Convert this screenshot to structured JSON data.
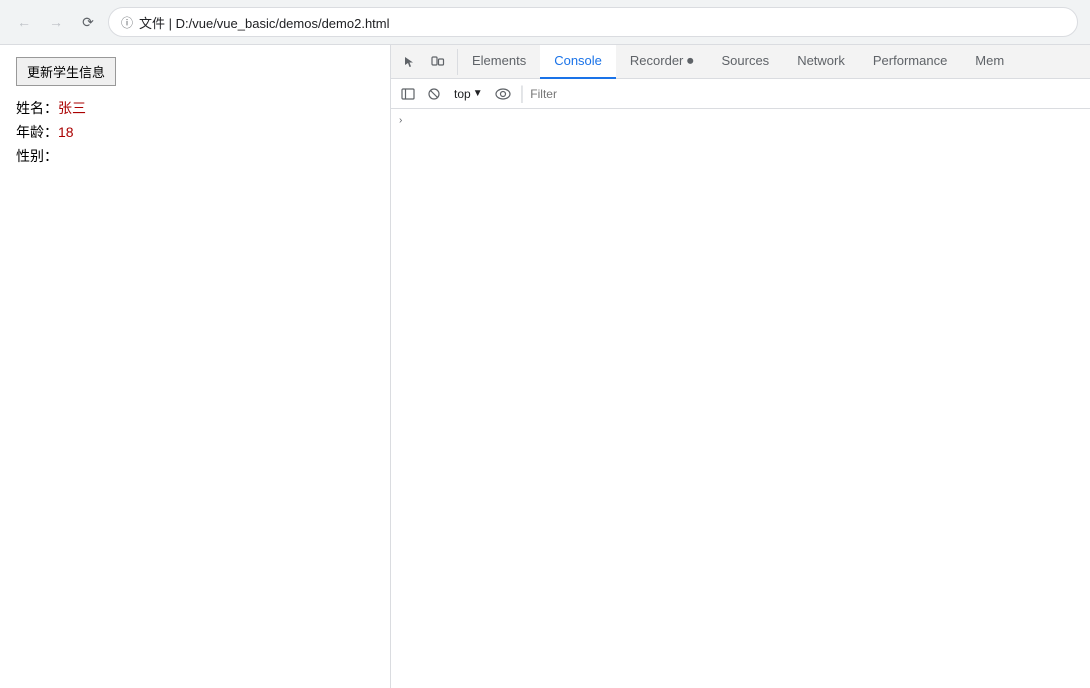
{
  "browser": {
    "back_disabled": true,
    "forward_disabled": true,
    "reload_label": "↻",
    "address_icon": "ℹ",
    "address_url": "文件  |  D:/vue/vue_basic/demos/demo2.html"
  },
  "page": {
    "update_button_label": "更新学生信息",
    "fields": [
      {
        "label": "姓名：",
        "value": "张三"
      },
      {
        "label": "年龄：",
        "value": "18"
      },
      {
        "label": "性别：",
        "value": ""
      }
    ]
  },
  "devtools": {
    "tabs": [
      {
        "id": "elements",
        "label": "Elements",
        "active": false
      },
      {
        "id": "console",
        "label": "Console",
        "active": true
      },
      {
        "id": "recorder",
        "label": "Recorder ⏺",
        "active": false
      },
      {
        "id": "sources",
        "label": "Sources",
        "active": false
      },
      {
        "id": "network",
        "label": "Network",
        "active": false
      },
      {
        "id": "performance",
        "label": "Performance",
        "active": false
      },
      {
        "id": "memory",
        "label": "Mem",
        "active": false
      }
    ],
    "console": {
      "top_label": "top",
      "filter_placeholder": "Filter",
      "arrow_symbol": "›"
    }
  }
}
